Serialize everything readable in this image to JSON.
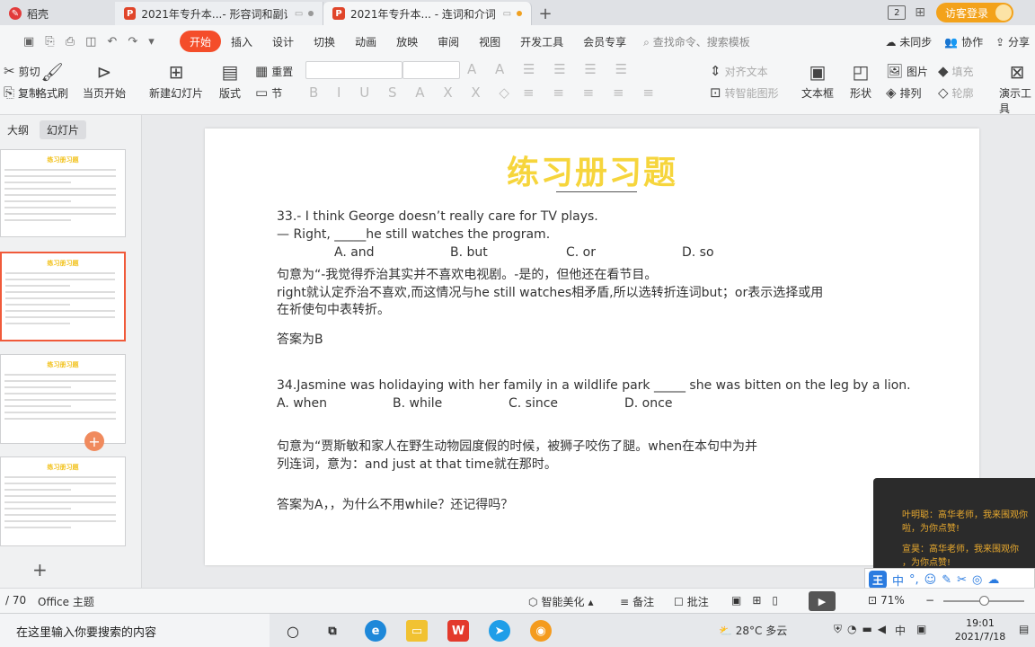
{
  "tabs": [
    {
      "label": "稻壳",
      "icon": "docer-logo-icon"
    },
    {
      "label": "2021年专升本...- 形容词和副词",
      "icon": "wps-presentation-icon"
    },
    {
      "label": "2021年专升本... - 连词和介词",
      "icon": "wps-presentation-icon",
      "active": true
    }
  ],
  "window": {
    "badge": "2",
    "login_label": "访客登录"
  },
  "menu": {
    "items": [
      "开始",
      "插入",
      "设计",
      "切换",
      "动画",
      "放映",
      "审阅",
      "视图",
      "开发工具",
      "会员专享"
    ],
    "search_placeholder": "查找命令、搜索模板",
    "right": [
      "未同步",
      "协作",
      "分享"
    ]
  },
  "ribbon": {
    "cut": "剪切",
    "copy": "复制",
    "format_painter": "格式刷",
    "play_from_current": "当页开始",
    "new_slide": "新建幻灯片",
    "layout": "版式",
    "section": "节",
    "reset": "重置",
    "align_text": "对齐文本",
    "smartart": "转智能图形",
    "textbox": "文本框",
    "shape": "形状",
    "picture": "图片",
    "arrange": "排列",
    "fill": "填充",
    "outline": "轮廓",
    "presenter_tools": "演示工具"
  },
  "left_panel": {
    "tab_outline": "大纲",
    "tab_slides": "幻灯片",
    "thumb_title": "练习册习题"
  },
  "slide": {
    "title": "练习册习题",
    "lines": [
      "33.- I think George doesn’t really care for TV plays.",
      "— Right, _____he still watches the program.",
      "A. and",
      "B. but",
      "C. or",
      "D. so",
      "句意为“-我觉得乔治其实并不喜欢电视剧。-是的，但他还在看节目。",
      "right就认定乔治不喜欢,而这情况与he still watches相矛盾,所以选转折连词but；or表示选择或用",
      "在祈使句中表转折。",
      "答案为B",
      "34.Jasmine was holidaying with her family in a wildlife park _____ she was bitten on the leg by a lion.",
      "A. when",
      "B. while",
      "C. since",
      "D. once",
      "句意为“贾斯敏和家人在野生动物园度假的时候，被狮子咬伤了腿。when在本句中为并",
      "列连词，意为：and just at that time就在那时。",
      "答案为A，，为什么不用while？还记得吗？"
    ]
  },
  "chat": {
    "messages": [
      "叶明聪：高华老师，我来围观你",
      "啦，为你点赞!",
      "宣昊：高华老师，我来围观你",
      "，为你点赞!"
    ]
  },
  "ime": {
    "label": "王",
    "mode": "中"
  },
  "status": {
    "page": "/ 70",
    "theme": "Office 主题",
    "beautify": "智能美化",
    "notes": "备注",
    "comments": "批注",
    "zoom": "71%"
  },
  "taskbar": {
    "search_placeholder": "在这里输入你要搜索的内容",
    "weather": "28°C 多云",
    "ime": "中",
    "time": "19:01",
    "date": "2021/7/18"
  },
  "colors": {
    "accent": "#f44d2a",
    "title_yellow": "#f6d53c",
    "chat_text": "#e8a92e"
  }
}
